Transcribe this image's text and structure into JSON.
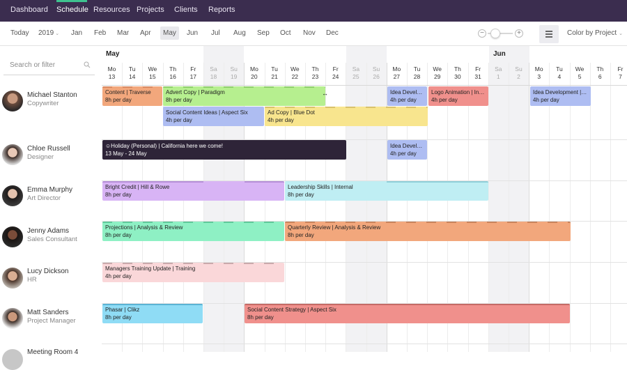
{
  "nav": {
    "items": [
      "Dashboard",
      "Schedule",
      "Resources",
      "Projects",
      "Clients",
      "Reports"
    ],
    "active": "Schedule",
    "accent": "#3ec28f",
    "background": "#3b2d4f"
  },
  "toolbar": {
    "today": "Today",
    "year": "2019",
    "months": [
      "Jan",
      "Feb",
      "Mar",
      "Apr",
      "May",
      "Jun",
      "Jul",
      "Aug",
      "Sep",
      "Oct",
      "Nov",
      "Dec"
    ],
    "active_month": "May",
    "zoom_minus": "−",
    "zoom_plus": "+",
    "color_by": "Color by Project"
  },
  "search": {
    "placeholder": "Search or filter"
  },
  "calendar": {
    "months": [
      "May",
      "Jun"
    ],
    "days": [
      {
        "d": "Mo",
        "n": "13"
      },
      {
        "d": "Tu",
        "n": "14"
      },
      {
        "d": "We",
        "n": "15"
      },
      {
        "d": "Th",
        "n": "16"
      },
      {
        "d": "Fr",
        "n": "17"
      },
      {
        "d": "Sa",
        "n": "18"
      },
      {
        "d": "Su",
        "n": "19"
      },
      {
        "d": "Mo",
        "n": "20"
      },
      {
        "d": "Tu",
        "n": "21"
      },
      {
        "d": "We",
        "n": "22"
      },
      {
        "d": "Th",
        "n": "23"
      },
      {
        "d": "Fr",
        "n": "24"
      },
      {
        "d": "Sa",
        "n": "25"
      },
      {
        "d": "Su",
        "n": "26"
      },
      {
        "d": "Mo",
        "n": "27"
      },
      {
        "d": "Tu",
        "n": "28"
      },
      {
        "d": "We",
        "n": "29"
      },
      {
        "d": "Th",
        "n": "30"
      },
      {
        "d": "Fr",
        "n": "31"
      },
      {
        "d": "Sa",
        "n": "1"
      },
      {
        "d": "Su",
        "n": "2"
      },
      {
        "d": "Mo",
        "n": "3"
      },
      {
        "d": "Tu",
        "n": "4"
      },
      {
        "d": "We",
        "n": "5"
      },
      {
        "d": "Th",
        "n": "6"
      },
      {
        "d": "Fr",
        "n": "7"
      }
    ]
  },
  "people": [
    {
      "name": "Michael Stanton",
      "role": "Copywriter"
    },
    {
      "name": "Chloe Russell",
      "role": "Designer"
    },
    {
      "name": "Emma Murphy",
      "role": "Art Director"
    },
    {
      "name": "Jenny Adams",
      "role": "Sales Consultant"
    },
    {
      "name": "Lucy Dickson",
      "role": "HR"
    },
    {
      "name": "Matt Sanders",
      "role": "Project Manager"
    },
    {
      "name": "Meeting Room 4",
      "role": ""
    }
  ],
  "tasks": [
    {
      "title": "Content | Traverse",
      "hours": "8h per day",
      "color": "#f2a77c"
    },
    {
      "title": "Advert Copy | Paradigm",
      "hours": "8h per day",
      "color": "#b6ef8f"
    },
    {
      "title": "Idea Develop...",
      "hours": "4h per day",
      "color": "#aebdf2"
    },
    {
      "title": "Logo Animation | Innate",
      "hours": "4h per day",
      "color": "#f0908c"
    },
    {
      "title": "Idea Development | As...",
      "hours": "4h per day",
      "color": "#aebdf2"
    },
    {
      "title": "Social Content Ideas | Aspect Six",
      "hours": "4h per day",
      "color": "#aebdf2"
    },
    {
      "title": "Ad Copy | Blue Dot",
      "hours": "4h per day",
      "color": "#f8e58e"
    },
    {
      "title": "Holiday (Personal) | California here we come!",
      "hours": "13 May - 24 May",
      "color": "#2e2438"
    },
    {
      "title": "Idea Develop...",
      "hours": "4h per day",
      "color": "#aebdf2"
    },
    {
      "title": "Bright Credit | Hill & Rowe",
      "hours": "8h per day",
      "color": "#d8b4f5"
    },
    {
      "title": "Leadership Skills | Internal",
      "hours": "8h per day",
      "color": "#bfeef3"
    },
    {
      "title": "Projections | Analysis & Review",
      "hours": "8h per day",
      "color": "#8ef0c4"
    },
    {
      "title": "Quarterly Review | Analysis & Review",
      "hours": "8h per day",
      "color": "#f2a77c"
    },
    {
      "title": "Managers Training Update | Training",
      "hours": "4h per day",
      "color": "#fad7d9"
    },
    {
      "title": "Phasar | Clikz",
      "hours": "8h per day",
      "color": "#8fdcf5"
    },
    {
      "title": "Social Content Strategy | Aspect Six",
      "hours": "8h per day",
      "color": "#f0908c"
    }
  ]
}
